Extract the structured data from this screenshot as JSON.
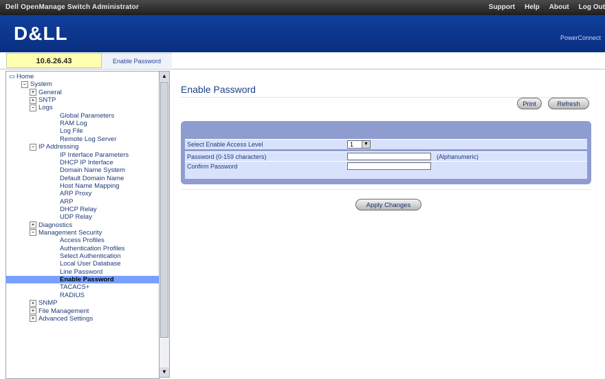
{
  "topbar": {
    "title": "Dell OpenManage Switch Administrator",
    "links": [
      "Support",
      "Help",
      "About",
      "Log Out"
    ]
  },
  "banner": {
    "logo": "D&LL",
    "tagline": "PowerConnect"
  },
  "location": {
    "ip": "10.6.26.43",
    "breadcrumb": "Enable Password"
  },
  "tree": [
    {
      "label": "Home",
      "depth": 0,
      "toggle": "",
      "selected": false
    },
    {
      "label": "System",
      "depth": 1,
      "toggle": "-",
      "selected": false
    },
    {
      "label": "General",
      "depth": 2,
      "toggle": "+",
      "selected": false
    },
    {
      "label": "SNTP",
      "depth": 2,
      "toggle": "+",
      "selected": false
    },
    {
      "label": "Logs",
      "depth": 2,
      "toggle": "-",
      "selected": false
    },
    {
      "label": "Global Parameters",
      "depth": 3,
      "toggle": "",
      "selected": false
    },
    {
      "label": "RAM Log",
      "depth": 3,
      "toggle": "",
      "selected": false
    },
    {
      "label": "Log File",
      "depth": 3,
      "toggle": "",
      "selected": false
    },
    {
      "label": "Remote Log Server",
      "depth": 3,
      "toggle": "",
      "selected": false
    },
    {
      "label": "IP Addressing",
      "depth": 2,
      "toggle": "-",
      "selected": false
    },
    {
      "label": "IP Interface Parameters",
      "depth": 3,
      "toggle": "",
      "selected": false
    },
    {
      "label": "DHCP IP Interface",
      "depth": 3,
      "toggle": "",
      "selected": false
    },
    {
      "label": "Domain Name System",
      "depth": 3,
      "toggle": "",
      "selected": false
    },
    {
      "label": "Default Domain Name",
      "depth": 3,
      "toggle": "",
      "selected": false
    },
    {
      "label": "Host Name Mapping",
      "depth": 3,
      "toggle": "",
      "selected": false
    },
    {
      "label": "ARP Proxy",
      "depth": 3,
      "toggle": "",
      "selected": false
    },
    {
      "label": "ARP",
      "depth": 3,
      "toggle": "",
      "selected": false
    },
    {
      "label": "DHCP Relay",
      "depth": 3,
      "toggle": "",
      "selected": false
    },
    {
      "label": "UDP Relay",
      "depth": 3,
      "toggle": "",
      "selected": false
    },
    {
      "label": "Diagnostics",
      "depth": 2,
      "toggle": "+",
      "selected": false
    },
    {
      "label": "Management Security",
      "depth": 2,
      "toggle": "-",
      "selected": false
    },
    {
      "label": "Access Profiles",
      "depth": 3,
      "toggle": "",
      "selected": false
    },
    {
      "label": "Authentication Profiles",
      "depth": 3,
      "toggle": "",
      "selected": false
    },
    {
      "label": "Select Authentication",
      "depth": 3,
      "toggle": "",
      "selected": false
    },
    {
      "label": "Local User Database",
      "depth": 3,
      "toggle": "",
      "selected": false
    },
    {
      "label": "Line Password",
      "depth": 3,
      "toggle": "",
      "selected": false
    },
    {
      "label": "Enable Password",
      "depth": 3,
      "toggle": "",
      "selected": true
    },
    {
      "label": "TACACS+",
      "depth": 3,
      "toggle": "",
      "selected": false
    },
    {
      "label": "RADIUS",
      "depth": 3,
      "toggle": "",
      "selected": false
    },
    {
      "label": "SNMP",
      "depth": 2,
      "toggle": "+",
      "selected": false
    },
    {
      "label": "File Management",
      "depth": 2,
      "toggle": "+",
      "selected": false
    },
    {
      "label": "Advanced Settings",
      "depth": 2,
      "toggle": "+",
      "selected": false
    }
  ],
  "page": {
    "title": "Enable Password",
    "print_label": "Print",
    "refresh_label": "Refresh",
    "apply_label": "Apply Changes"
  },
  "form": {
    "access_level_label": "Select Enable Access Level",
    "access_level_value": "1",
    "password_label": "Password (0-159 characters)",
    "password_hint": "(Alphanumeric)",
    "confirm_label": "Confirm Password"
  },
  "colors": {
    "banner": "#0f3f9c",
    "form_border": "#8e9cd0",
    "form_row": "#d9e2fb",
    "selected_item": "#7aa0ff"
  }
}
